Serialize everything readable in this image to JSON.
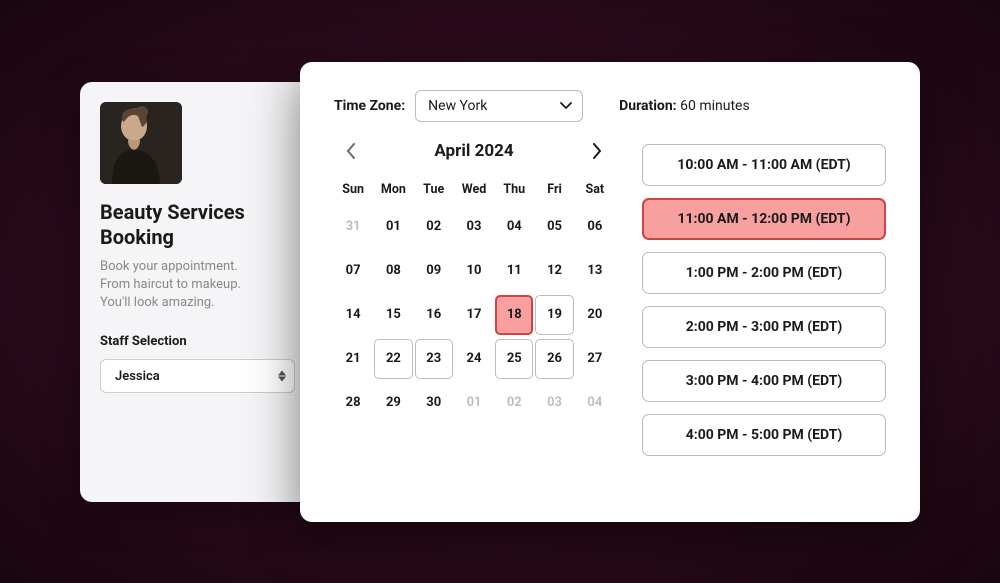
{
  "sidebar": {
    "title": "Beauty Services Booking",
    "subtitle": "Book your appointment.\nFrom haircut to makeup.\nYou'll look amazing.",
    "staff_label": "Staff Selection",
    "staff_value": "Jessica"
  },
  "timezone": {
    "label": "Time Zone:",
    "value": "New York"
  },
  "duration": {
    "label": "Duration:",
    "value": "60 minutes"
  },
  "calendar": {
    "month_label": "April 2024",
    "dow": [
      "Sun",
      "Mon",
      "Tue",
      "Wed",
      "Thu",
      "Fri",
      "Sat"
    ],
    "days": [
      {
        "n": "31",
        "dim": true
      },
      {
        "n": "01"
      },
      {
        "n": "02"
      },
      {
        "n": "03"
      },
      {
        "n": "04"
      },
      {
        "n": "05"
      },
      {
        "n": "06"
      },
      {
        "n": "07"
      },
      {
        "n": "08"
      },
      {
        "n": "09"
      },
      {
        "n": "10"
      },
      {
        "n": "11"
      },
      {
        "n": "12"
      },
      {
        "n": "13"
      },
      {
        "n": "14"
      },
      {
        "n": "15"
      },
      {
        "n": "16"
      },
      {
        "n": "17"
      },
      {
        "n": "18",
        "selected": true
      },
      {
        "n": "19",
        "avail": true
      },
      {
        "n": "20"
      },
      {
        "n": "21"
      },
      {
        "n": "22",
        "avail": true
      },
      {
        "n": "23",
        "avail": true
      },
      {
        "n": "24"
      },
      {
        "n": "25",
        "avail": true
      },
      {
        "n": "26",
        "avail": true
      },
      {
        "n": "27"
      },
      {
        "n": "28"
      },
      {
        "n": "29"
      },
      {
        "n": "30"
      },
      {
        "n": "01",
        "dim": true
      },
      {
        "n": "02",
        "dim": true
      },
      {
        "n": "03",
        "dim": true
      },
      {
        "n": "04",
        "dim": true
      }
    ]
  },
  "slots": [
    {
      "label": "10:00 AM - 11:00 AM (EDT)",
      "selected": false
    },
    {
      "label": "11:00 AM - 12:00 PM (EDT)",
      "selected": true
    },
    {
      "label": "1:00 PM - 2:00 PM (EDT)",
      "selected": false
    },
    {
      "label": "2:00 PM - 3:00 PM (EDT)",
      "selected": false
    },
    {
      "label": "3:00 PM - 4:00 PM (EDT)",
      "selected": false
    },
    {
      "label": "4:00 PM - 5:00 PM (EDT)",
      "selected": false
    }
  ],
  "colors": {
    "accent_bg": "#f8a0a0",
    "accent_border": "#cc4444"
  }
}
